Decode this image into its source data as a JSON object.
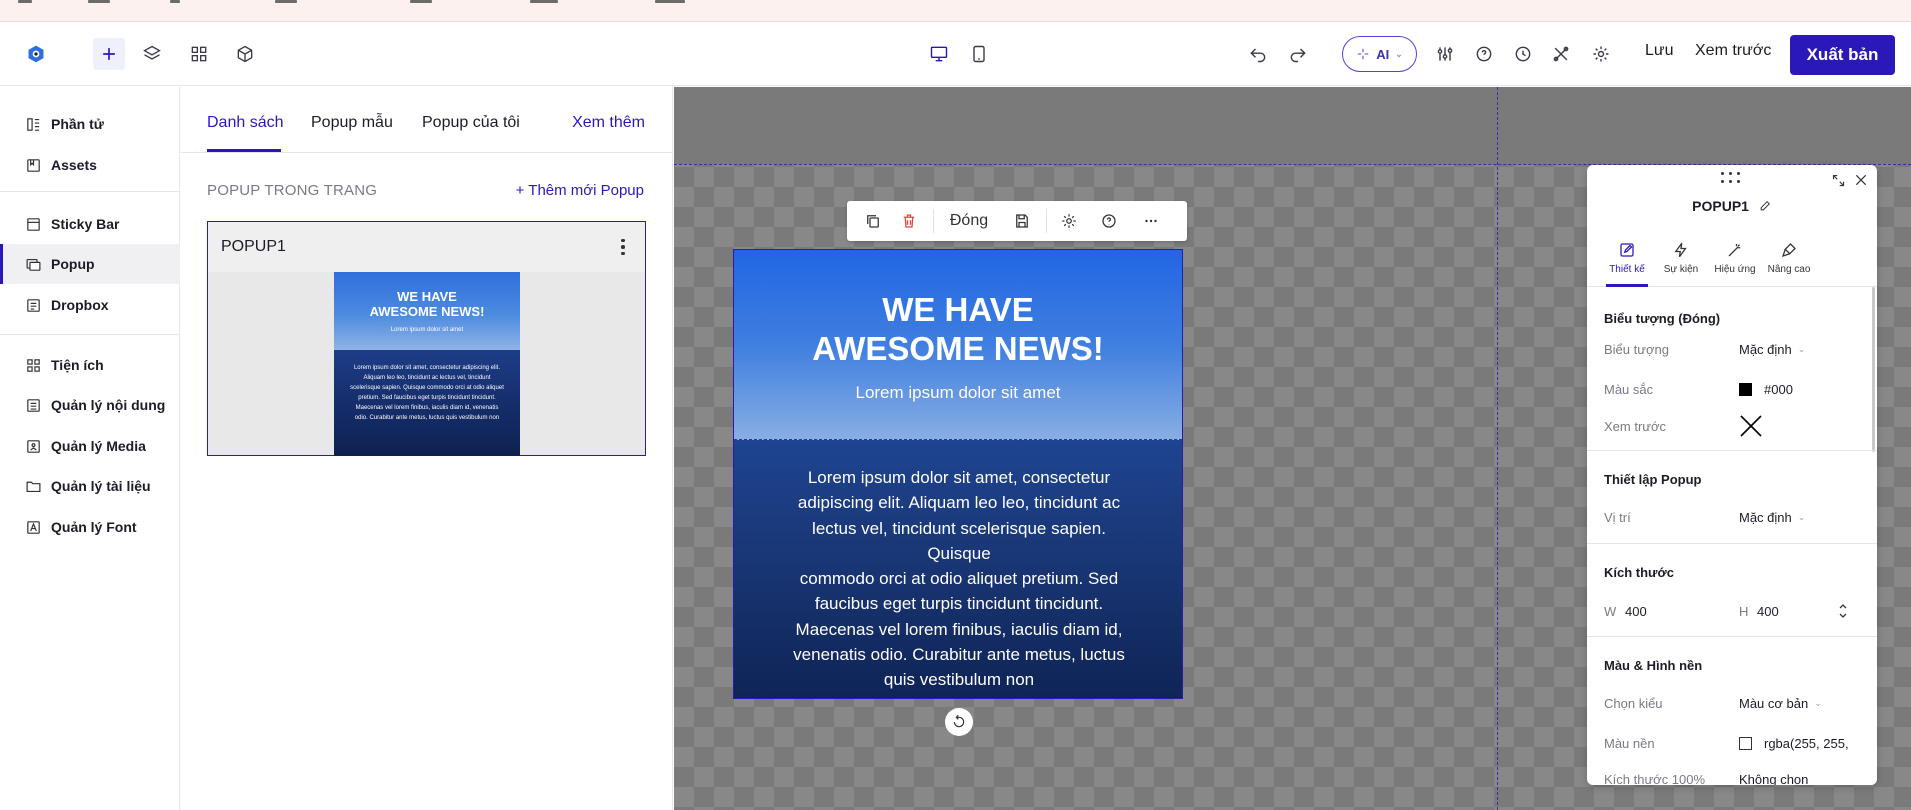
{
  "header": {
    "save_label": "Lưu",
    "preview_label": "Xem trước",
    "publish_label": "Xuất bản",
    "ai_label": "AI",
    "icons": [
      "logo-icon",
      "add-icon",
      "layers-icon",
      "grid-icon",
      "cube-icon",
      "desktop-icon",
      "mobile-icon",
      "undo-icon",
      "redo-icon",
      "sliders-icon",
      "help-icon",
      "history-icon",
      "tools-icon",
      "gear-icon"
    ]
  },
  "sidebar": {
    "items": [
      {
        "label": "Phần tử",
        "icon": "elements-icon"
      },
      {
        "label": "Assets",
        "icon": "assets-icon"
      },
      {
        "label": "Sticky Bar",
        "icon": "sticky-bar-icon"
      },
      {
        "label": "Popup",
        "icon": "popup-icon",
        "active": true
      },
      {
        "label": "Dropbox",
        "icon": "dropbox-icon"
      },
      {
        "label": "Tiện ích",
        "icon": "utilities-icon"
      },
      {
        "label": "Quản lý nội dung",
        "icon": "content-icon"
      },
      {
        "label": "Quản lý Media",
        "icon": "media-icon"
      },
      {
        "label": "Quản lý tài liệu",
        "icon": "folder-icon"
      },
      {
        "label": "Quản lý Font",
        "icon": "font-icon"
      }
    ]
  },
  "panel": {
    "tabs": [
      "Danh sách",
      "Popup mẫu",
      "Popup của tôi"
    ],
    "see_more": "Xem thêm",
    "section_title": "POPUP TRONG TRANG",
    "add_new": "Thêm mới Popup",
    "card": {
      "name": "POPUP1",
      "thumb_title_1": "WE HAVE",
      "thumb_title_2": "AWESOME NEWS!",
      "thumb_sub": "Lorem ipsum dolor sit amet",
      "thumb_body": "Lorem ipsum dolor sit amet, consectetur adipiscing elit. Aliquam leo leo, tincidunt ac lectus vel, tincidunt scelerisque sapien. Quisque commodo orci at odio aliquet pretium. Sed faucibus eget turpis tincidunt tincidunt. Maecenas vel lorem finibus, iaculis diam id, venenatis odio. Curabitur ante metus, luctus quis vestibulum non"
    }
  },
  "toolbar": {
    "close_label": "Đóng"
  },
  "popup": {
    "title_1": "WE HAVE",
    "title_2": "AWESOME NEWS!",
    "subtitle": "Lorem ipsum dolor sit amet",
    "body_lines": [
      "Lorem ipsum dolor sit amet, consectetur",
      "adipiscing elit. Aliquam leo leo, tincidunt ac",
      "lectus vel, tincidunt scelerisque sapien. Quisque",
      "commodo orci at odio aliquet pretium. Sed",
      "faucibus eget turpis tincidunt tincidunt.",
      "Maecenas vel lorem finibus, iaculis diam id,",
      "venenatis odio. Curabitur ante metus, luctus",
      "quis vestibulum non"
    ]
  },
  "props": {
    "title": "POPUP1",
    "tabs": [
      "Thiết kế",
      "Sự kiện",
      "Hiệu ứng",
      "Nâng cao"
    ],
    "section_icon": "Biểu tượng (Đóng)",
    "icon_label": "Biểu tượng",
    "icon_value": "Mặc định",
    "color_label": "Màu sắc",
    "color_value": "#000",
    "preview_label": "Xem trước",
    "section_setup": "Thiết lập Popup",
    "position_label": "Vị trí",
    "position_value": "Mặc định",
    "section_size": "Kích thước",
    "w_label": "W",
    "w_value": "400",
    "h_label": "H",
    "h_value": "400",
    "section_bg": "Màu & Hình nền",
    "style_label": "Chọn kiểu",
    "style_value": "Màu cơ bản",
    "bg_label": "Màu nền",
    "bg_value": "rgba(255, 255,",
    "size100_label": "Kích thước 100%",
    "size100_value": "Không chọn"
  },
  "colors": {
    "accent": "#2b18b8",
    "popup_top": "#2265e2",
    "popup_bottom": "#0f2456"
  }
}
